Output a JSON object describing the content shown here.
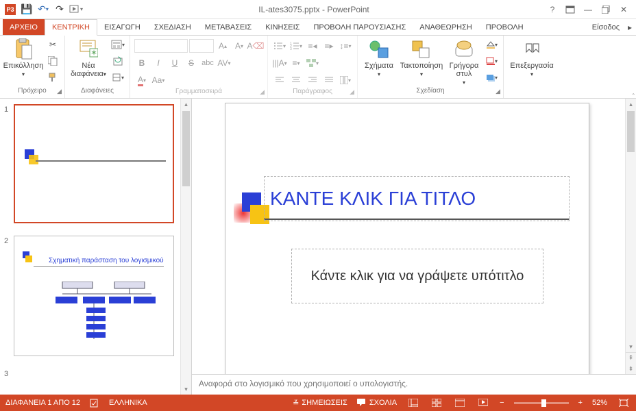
{
  "title": "IL-ates3075.pptx - PowerPoint",
  "qat": {
    "app": "P3"
  },
  "tabs": {
    "file": "ΑΡΧΕΙΟ",
    "home": "ΚΕΝΤΡΙΚΗ",
    "insert": "ΕΙΣΑΓΩΓΗ",
    "design": "ΣΧΕΔΙΑΣΗ",
    "transitions": "ΜΕΤΑΒΑΣΕΙΣ",
    "animations": "ΚΙΝΗΣΕΙΣ",
    "slideshow": "ΠΡΟΒΟΛΗ ΠΑΡΟΥΣΙΑΣΗΣ",
    "review": "ΑΝΑΘΕΩΡΗΣΗ",
    "view": "ΠΡΟΒΟΛΗ",
    "signin": "Είσοδος"
  },
  "ribbon": {
    "clipboard": {
      "label": "Πρόχειρο",
      "paste": "Επικόλληση"
    },
    "slides": {
      "label": "Διαφάνειες",
      "new": "Νέα διαφάνεια"
    },
    "font": {
      "label": "Γραμματοσειρά"
    },
    "paragraph": {
      "label": "Παράγραφος"
    },
    "drawing": {
      "label": "Σχεδίαση",
      "shapes": "Σχήματα",
      "arrange": "Τακτοποίηση",
      "styles": "Γρήγορα στυλ"
    },
    "editing": {
      "label": "Επεξεργασία",
      "find": "Επεξεργασία"
    }
  },
  "thumbs": {
    "n1": "1",
    "n2": "2",
    "n3": "3",
    "slide2_title": "Σχηματική παράσταση του λογισμικού"
  },
  "slide": {
    "title_placeholder": "ΚΑΝΤΕ ΚΛΙΚ ΓΙΑ ΤΙΤΛΟ",
    "subtitle_placeholder": "Κάντε κλικ για να γράψετε υπότιτλο"
  },
  "notes": "Αναφορά στο λογισμικό που χρησιμοποιεί ο υπολογιστής.",
  "status": {
    "slide_counter": "ΔΙΑΦΑΝΕΙΑ 1 ΑΠΟ 12",
    "lang": "ΕΛΛΗΝΙΚΑ",
    "notes_btn": "ΣΗΜΕΙΩΣΕΙΣ",
    "comments_btn": "ΣΧΟΛΙΑ",
    "zoom": "52%"
  }
}
